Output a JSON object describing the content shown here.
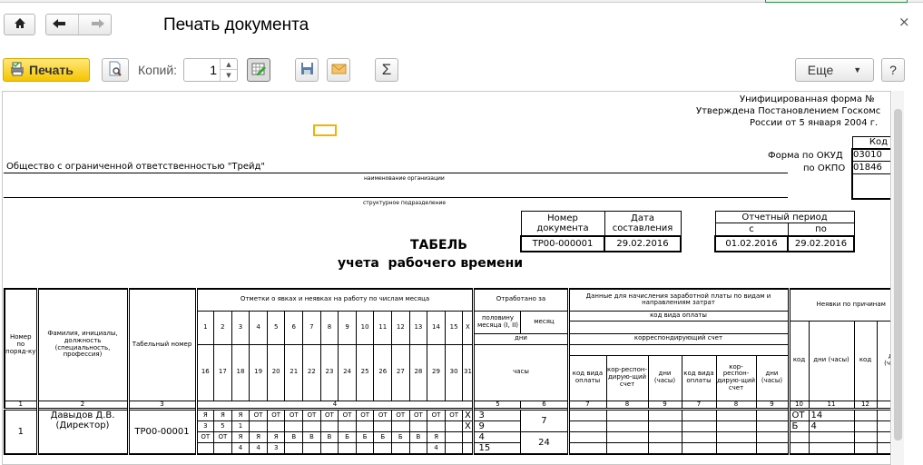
{
  "window": {
    "title": "Печать документа",
    "close": "×"
  },
  "toolbar": {
    "print": "Печать",
    "copies_label": "Копий:",
    "copies_value": "1",
    "more": "Еще",
    "help": "?",
    "sigma": "Σ"
  },
  "colors": {
    "print_button": "#f5c500",
    "green_strip": "#1a9a3a"
  },
  "form": {
    "unified": "Унифицированная форма №",
    "approved": "Утверждена Постановлением Госкомс",
    "russia": "России от 5 января 2004 г.",
    "code_header": "Код",
    "okud_label": "Форма по ОКУД",
    "okud": "03010",
    "okpo_label": "по ОКПО",
    "okpo": "01846",
    "org": "Общество с ограниченной ответственностью \"Трейд\"",
    "org_caption": "наименование организации",
    "dept_caption": "структурное подразделение",
    "doc_num_header": "Номер документа",
    "doc_date_header": "Дата составления",
    "doc_num": "ТР00-000001",
    "doc_date": "29.02.2016",
    "period_header": "Отчетный период",
    "period_from_label": "с",
    "period_to_label": "по",
    "period_from": "01.02.2016",
    "period_to": "29.02.2016",
    "title1": "ТАБЕЛЬ",
    "title2": "учета  рабочего времени"
  },
  "table": {
    "h_num": "Номер по поряд-ку",
    "h_name": "Фамилия, инициалы, должность (специальность, профессия)",
    "h_tab": "Табельный номер",
    "h_marks": "Отметки о явках и неявках на работу по числам месяца",
    "days1": [
      "1",
      "2",
      "3",
      "4",
      "5",
      "6",
      "7",
      "8",
      "9",
      "10",
      "11",
      "12",
      "13",
      "14",
      "15",
      "X"
    ],
    "days2": [
      "16",
      "17",
      "18",
      "19",
      "20",
      "21",
      "22",
      "23",
      "24",
      "25",
      "26",
      "27",
      "28",
      "29",
      "30",
      "31"
    ],
    "h_worked": "Отработано за",
    "h_half": "половину месяца (I, II)",
    "h_month": "месяц",
    "h_days": "дни",
    "h_hours": "часы",
    "h_pay": "Данные для начисления заработной платы по видам и направлениям затрат",
    "h_paycode": "код вида оплаты",
    "h_corr": "корреспондирующий счет",
    "pay_sub": [
      "код вида оплаты",
      "кор-респон-дирую-щий счет",
      "дни (часы)",
      "код вида оплаты",
      "кор-респон-дирую-щий счет",
      "дни (часы)"
    ],
    "h_absence": "Неявки по причинам",
    "abs_sub": [
      "код",
      "дни (часы)",
      "код",
      "дни (часы)"
    ],
    "colnums": {
      "c1": "1",
      "c2": "2",
      "c3": "3",
      "c4": "4",
      "c5": "5",
      "c6": "6",
      "pay": [
        "7",
        "8",
        "9",
        "7",
        "8",
        "9"
      ],
      "abs": [
        "10",
        "11",
        "12",
        ""
      ]
    },
    "employee": {
      "num": "1",
      "name": "Давыдов Д.В.",
      "position": "(Директор)",
      "tab": "ТР00-00001",
      "days": [
        [
          "Я",
          "Я",
          "Я",
          "ОТ",
          "ОТ",
          "ОТ",
          "ОТ",
          "ОТ",
          "ОТ",
          "ОТ",
          "ОТ",
          "ОТ",
          "ОТ",
          "ОТ",
          "ОТ",
          "X"
        ],
        [
          "3",
          "5",
          "1",
          "",
          "",
          "",
          "",
          "",
          "",
          "",
          "",
          "",
          "",
          "",
          "",
          "X"
        ],
        [
          "ОТ",
          "ОТ",
          "Я",
          "Я",
          "Я",
          "В",
          "В",
          "В",
          "Б",
          "Б",
          "Б",
          "Б",
          "В",
          "Я",
          "",
          ""
        ],
        [
          "",
          "",
          "4",
          "4",
          "3",
          "",
          "",
          "",
          "",
          "",
          "",
          "",
          "",
          "4",
          "",
          ""
        ]
      ],
      "half": [
        "3",
        "9",
        "4",
        "15"
      ],
      "month": [
        "7",
        "24"
      ],
      "absence": [
        [
          "ОТ",
          "14",
          "",
          ""
        ],
        [
          "Б",
          "4",
          "",
          ""
        ],
        [
          "",
          "",
          "",
          ""
        ],
        [
          "",
          "",
          "",
          ""
        ]
      ]
    }
  }
}
